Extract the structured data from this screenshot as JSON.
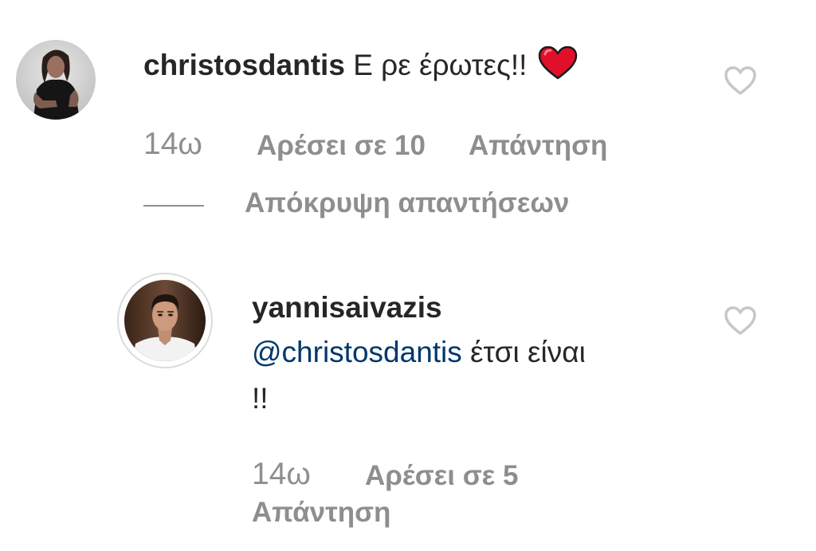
{
  "comments": [
    {
      "username": "christosdantis",
      "text": "Ε ρε έρωτες!!",
      "emoji": "red-heart",
      "time": "14ω",
      "likes_label": "Αρέσει σε 10",
      "reply_label": "Απάντηση",
      "like_icon": "heart-outline-icon"
    },
    {
      "username": "yannisaivazis",
      "mention": "@christosdantis",
      "text_line1": " έτσι είναι",
      "text_line2": "!!",
      "time": "14ω",
      "likes_label": "Αρέσει σε 5",
      "reply_label": "Απάντηση",
      "like_icon": "heart-outline-icon"
    }
  ],
  "replies_toggle": {
    "label": "Απόκρυψη απαντήσεων"
  },
  "colors": {
    "text": "#262626",
    "secondary": "#8e8e8e",
    "mention": "#00376b",
    "emoji_heart": "#e0102a"
  }
}
